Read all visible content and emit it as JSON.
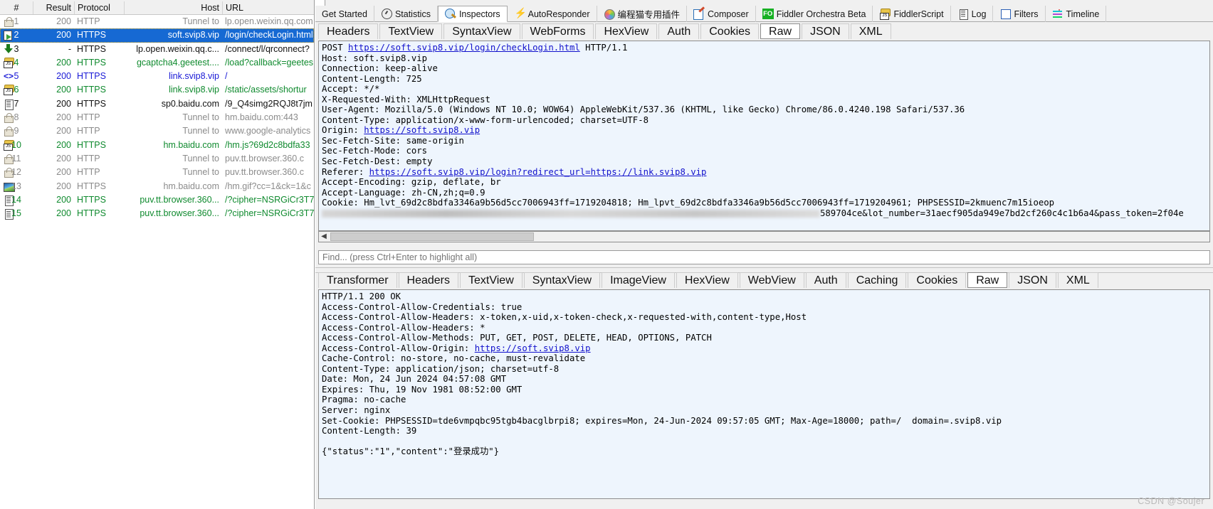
{
  "sessions": {
    "columns": [
      "#",
      "Result",
      "Protocol",
      "Host",
      "URL"
    ],
    "rows": [
      {
        "icon": "lock-icon",
        "num": "1",
        "result": "200",
        "protocol": "HTTP",
        "host": "Tunnel to",
        "url": "lp.open.weixin.qq.com",
        "color": "gray",
        "selected": false
      },
      {
        "icon": "send-icon",
        "num": "2",
        "result": "200",
        "protocol": "HTTPS",
        "host": "soft.svip8.vip",
        "url": "/login/checkLogin.html",
        "color": "white",
        "selected": true
      },
      {
        "icon": "arrow-down-icon",
        "num": "3",
        "result": "-",
        "protocol": "HTTPS",
        "host": "lp.open.weixin.qq.c...",
        "url": "/connect/l/qrconnect?",
        "color": "black",
        "selected": false
      },
      {
        "icon": "js-icon",
        "num": "4",
        "result": "200",
        "protocol": "HTTPS",
        "host": "gcaptcha4.geetest....",
        "url": "/load?callback=geetes",
        "color": "green",
        "selected": false
      },
      {
        "icon": "code-icon",
        "num": "5",
        "result": "200",
        "protocol": "HTTPS",
        "host": "link.svip8.vip",
        "url": "/",
        "color": "blue",
        "selected": false
      },
      {
        "icon": "js-icon",
        "num": "6",
        "result": "200",
        "protocol": "HTTPS",
        "host": "link.svip8.vip",
        "url": "/static/assets/shortur",
        "color": "green",
        "selected": false
      },
      {
        "icon": "doc-icon",
        "num": "7",
        "result": "200",
        "protocol": "HTTPS",
        "host": "sp0.baidu.com",
        "url": "/9_Q4simg2RQJ8t7jm",
        "color": "black",
        "selected": false
      },
      {
        "icon": "lock-icon",
        "num": "8",
        "result": "200",
        "protocol": "HTTP",
        "host": "Tunnel to",
        "url": "hm.baidu.com:443",
        "color": "gray",
        "selected": false
      },
      {
        "icon": "lock-icon",
        "num": "9",
        "result": "200",
        "protocol": "HTTP",
        "host": "Tunnel to",
        "url": "www.google-analytics",
        "color": "gray",
        "selected": false
      },
      {
        "icon": "js-icon",
        "num": "10",
        "result": "200",
        "protocol": "HTTPS",
        "host": "hm.baidu.com",
        "url": "/hm.js?69d2c8bdfa33",
        "color": "green",
        "selected": false
      },
      {
        "icon": "lock-icon",
        "num": "11",
        "result": "200",
        "protocol": "HTTP",
        "host": "Tunnel to",
        "url": "puv.tt.browser.360.c",
        "color": "gray",
        "selected": false
      },
      {
        "icon": "lock-icon",
        "num": "12",
        "result": "200",
        "protocol": "HTTP",
        "host": "Tunnel to",
        "url": "puv.tt.browser.360.c",
        "color": "gray",
        "selected": false
      },
      {
        "icon": "image-icon",
        "num": "13",
        "result": "200",
        "protocol": "HTTPS",
        "host": "hm.baidu.com",
        "url": "/hm.gif?cc=1&ck=1&c",
        "color": "gray",
        "selected": false
      },
      {
        "icon": "doc-icon",
        "num": "14",
        "result": "200",
        "protocol": "HTTPS",
        "host": "puv.tt.browser.360...",
        "url": "/?cipher=NSRGiCr3T7",
        "color": "green",
        "selected": false
      },
      {
        "icon": "doc-icon",
        "num": "15",
        "result": "200",
        "protocol": "HTTPS",
        "host": "puv.tt.browser.360...",
        "url": "/?cipher=NSRGiCr3T7",
        "color": "green",
        "selected": false
      }
    ]
  },
  "main_tabs": [
    {
      "label": "Get Started",
      "icon": "",
      "active": false
    },
    {
      "label": "Statistics",
      "icon": "gi-stats",
      "active": false
    },
    {
      "label": "Inspectors",
      "icon": "gi-insp",
      "active": true
    },
    {
      "label": "AutoResponder",
      "icon": "gi-auto",
      "active": false
    },
    {
      "label": "编程猫专用插件",
      "icon": "gi-plugin",
      "active": false
    },
    {
      "label": "Composer",
      "icon": "gi-comp",
      "active": false
    },
    {
      "label": "Fiddler Orchestra Beta",
      "icon": "gi-fo",
      "active": false
    },
    {
      "label": "FiddlerScript",
      "icon": "gi-fs",
      "active": false
    },
    {
      "label": "Log",
      "icon": "gi-log",
      "active": false
    },
    {
      "label": "Filters",
      "icon": "gi-filt",
      "active": false
    },
    {
      "label": "Timeline",
      "icon": "gi-time",
      "active": false
    }
  ],
  "request": {
    "tabs": [
      {
        "label": "Headers",
        "active": false
      },
      {
        "label": "TextView",
        "active": false
      },
      {
        "label": "SyntaxView",
        "active": false
      },
      {
        "label": "WebForms",
        "active": false
      },
      {
        "label": "HexView",
        "active": false
      },
      {
        "label": "Auth",
        "active": false
      },
      {
        "label": "Cookies",
        "active": false
      },
      {
        "label": "Raw",
        "active": true
      },
      {
        "label": "JSON",
        "active": false
      },
      {
        "label": "XML",
        "active": false
      }
    ],
    "raw_lines": [
      {
        "pre": "POST ",
        "link": "https://soft.svip8.vip/login/checkLogin.html",
        "post": " HTTP/1.1"
      },
      {
        "text": "Host: soft.svip8.vip"
      },
      {
        "text": "Connection: keep-alive"
      },
      {
        "text": "Content-Length: 725"
      },
      {
        "text": "Accept: */*"
      },
      {
        "text": "X-Requested-With: XMLHttpRequest"
      },
      {
        "text": "User-Agent: Mozilla/5.0 (Windows NT 10.0; WOW64) AppleWebKit/537.36 (KHTML, like Gecko) Chrome/86.0.4240.198 Safari/537.36"
      },
      {
        "text": "Content-Type: application/x-www-form-urlencoded; charset=UTF-8"
      },
      {
        "pre": "Origin: ",
        "link": "https://soft.svip8.vip",
        "post": ""
      },
      {
        "text": "Sec-Fetch-Site: same-origin"
      },
      {
        "text": "Sec-Fetch-Mode: cors"
      },
      {
        "text": "Sec-Fetch-Dest: empty"
      },
      {
        "pre": "Referer: ",
        "link": "https://soft.svip8.vip/login?redirect_url=https://link.svip8.vip",
        "post": ""
      },
      {
        "text": "Accept-Encoding: gzip, deflate, br"
      },
      {
        "text": "Accept-Language: zh-CN,zh;q=0.9"
      },
      {
        "text": "Cookie: Hm_lvt_69d2c8bdfa3346a9b56d5cc7006943ff=1719204818; Hm_lpvt_69d2c8bdfa3346a9b56d5cc7006943ff=1719204961; PHPSESSID=2kmuenc7m15ioeop"
      },
      {
        "text": "",
        "blurred": true,
        "tail": "589704ce&lot_number=31aecf905da949e7bd2cf260c4c1b6a4&pass_token=2f04e"
      }
    ],
    "find_placeholder": "Find... (press Ctrl+Enter to highlight all)"
  },
  "response": {
    "tabs": [
      {
        "label": "Transformer",
        "active": false
      },
      {
        "label": "Headers",
        "active": false
      },
      {
        "label": "TextView",
        "active": false
      },
      {
        "label": "SyntaxView",
        "active": false
      },
      {
        "label": "ImageView",
        "active": false
      },
      {
        "label": "HexView",
        "active": false
      },
      {
        "label": "WebView",
        "active": false
      },
      {
        "label": "Auth",
        "active": false
      },
      {
        "label": "Caching",
        "active": false
      },
      {
        "label": "Cookies",
        "active": false
      },
      {
        "label": "Raw",
        "active": true
      },
      {
        "label": "JSON",
        "active": false
      },
      {
        "label": "XML",
        "active": false
      }
    ],
    "raw_lines": [
      {
        "text": "HTTP/1.1 200 OK"
      },
      {
        "text": "Access-Control-Allow-Credentials: true"
      },
      {
        "text": "Access-Control-Allow-Headers: x-token,x-uid,x-token-check,x-requested-with,content-type,Host"
      },
      {
        "text": "Access-Control-Allow-Headers: *"
      },
      {
        "text": "Access-Control-Allow-Methods: PUT, GET, POST, DELETE, HEAD, OPTIONS, PATCH"
      },
      {
        "pre": "Access-Control-Allow-Origin: ",
        "link": "https://soft.svip8.vip",
        "post": ""
      },
      {
        "text": "Cache-Control: no-store, no-cache, must-revalidate"
      },
      {
        "text": "Content-Type: application/json; charset=utf-8"
      },
      {
        "text": "Date: Mon, 24 Jun 2024 04:57:08 GMT"
      },
      {
        "text": "Expires: Thu, 19 Nov 1981 08:52:00 GMT"
      },
      {
        "text": "Pragma: no-cache"
      },
      {
        "text": "Server: nginx"
      },
      {
        "text": "Set-Cookie: PHPSESSID=tde6vmpqbc95tgb4bacglbrpi8; expires=Mon, 24-Jun-2024 09:57:05 GMT; Max-Age=18000; path=/  domain=.svip8.vip"
      },
      {
        "text": "Content-Length: 39"
      },
      {
        "text": ""
      },
      {
        "text": "{\"status\":\"1\",\"content\":\"登录成功\"}"
      }
    ],
    "highlight_text": "domain=.svip8.vip",
    "highlight_color": "#f02b2b"
  },
  "watermark": "CSDN @Soujer",
  "colors": {
    "selection": "#1669d3",
    "body_bg": "#eef5fd",
    "chrome": "#f0f0f0",
    "link": "#1111cc"
  }
}
